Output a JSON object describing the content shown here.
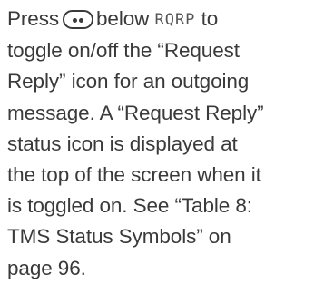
{
  "instruction": {
    "line1_pre": "Press",
    "key_icon": "two-dot-softkey-icon",
    "line1_mid": "below",
    "softkey_label": "RQRP",
    "line1_post": "to",
    "line2": "toggle on/off the “Request",
    "line3": "Reply” icon for an outgoing",
    "line4": "message. A “Request Reply”",
    "line5": "status icon is displayed at",
    "line6": "the top of the screen when it",
    "line7": "is toggled on. See “Table 8:",
    "line8": "TMS Status Symbols” on",
    "line9": "page 96."
  },
  "colors": {
    "text": "#3a3a3a",
    "softkey_label": "#555555"
  }
}
